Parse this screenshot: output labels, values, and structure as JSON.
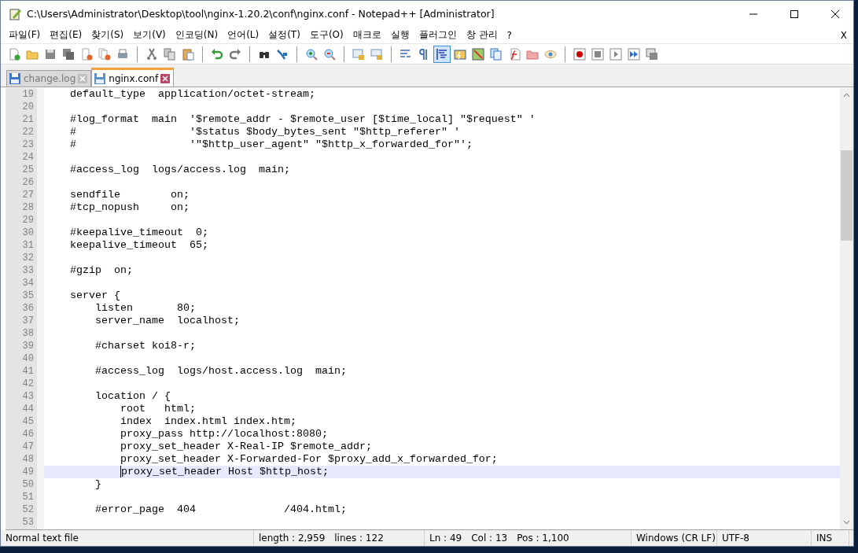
{
  "window": {
    "title": "C:\\Users\\Administrator\\Desktop\\tool\\nginx-1.20.2\\conf\\nginx.conf - Notepad++ [Administrator]"
  },
  "menu": {
    "items": [
      "파일(F)",
      "편집(E)",
      "찾기(S)",
      "보기(V)",
      "인코딩(N)",
      "언어(L)",
      "설정(T)",
      "도구(O)",
      "매크로",
      "실행",
      "플러그인",
      "창 관리",
      "?"
    ],
    "close_label": "X"
  },
  "toolbar": [
    [
      {
        "pressed": false
      },
      {
        "pressed": false
      },
      {
        "pressed": false
      },
      {
        "pressed": false
      },
      {
        "pressed": false
      },
      {
        "pressed": false
      },
      {
        "pressed": false
      }
    ],
    [
      {
        "pressed": false
      },
      {
        "pressed": false
      },
      {
        "pressed": false
      }
    ],
    [
      {
        "pressed": false
      },
      {
        "pressed": false
      }
    ],
    [
      {
        "pressed": false
      },
      {
        "pressed": false
      }
    ],
    [
      {
        "pressed": false
      },
      {
        "pressed": false
      }
    ],
    [
      {
        "pressed": false
      },
      {
        "pressed": false
      }
    ],
    [
      {
        "pressed": false
      },
      {
        "pressed": false
      },
      {
        "pressed": true
      },
      {
        "pressed": false
      },
      {
        "pressed": false
      },
      {
        "pressed": false
      },
      {
        "pressed": false
      },
      {
        "pressed": false
      },
      {
        "pressed": false
      }
    ],
    [
      {
        "pressed": false
      },
      {
        "pressed": false
      },
      {
        "pressed": false
      },
      {
        "pressed": false
      },
      {
        "pressed": false
      }
    ]
  ],
  "tabs": [
    {
      "label": "change.log",
      "selected": false
    },
    {
      "label": "nginx.conf",
      "selected": true
    }
  ],
  "editor": {
    "lines": [
      {
        "number": "19",
        "text": "    default_type  application/octet-stream;",
        "current": false
      },
      {
        "number": "20",
        "current": false
      },
      {
        "number": "21",
        "text": "    #log_format  main  '$remote_addr - $remote_user [$time_local] \"$request\" '",
        "current": false
      },
      {
        "number": "22",
        "text": "    #                  '$status $body_bytes_sent \"$http_referer\" '",
        "current": false
      },
      {
        "number": "23",
        "text": "    #                  '\"$http_user_agent\" \"$http_x_forwarded_for\"';",
        "current": false
      },
      {
        "number": "24",
        "current": false
      },
      {
        "number": "25",
        "text": "    #access_log  logs/access.log  main;",
        "current": false
      },
      {
        "number": "26",
        "current": false
      },
      {
        "number": "27",
        "text": "    sendfile        on;",
        "current": false
      },
      {
        "number": "28",
        "text": "    #tcp_nopush     on;",
        "current": false
      },
      {
        "number": "29",
        "current": false
      },
      {
        "number": "30",
        "text": "    #keepalive_timeout  0;",
        "current": false
      },
      {
        "number": "31",
        "text": "    keepalive_timeout  65;",
        "current": false
      },
      {
        "number": "32",
        "current": false
      },
      {
        "number": "33",
        "text": "    #gzip  on;",
        "current": false
      },
      {
        "number": "34",
        "current": false
      },
      {
        "number": "35",
        "text": "    server {",
        "current": false
      },
      {
        "number": "36",
        "text": "        listen       80;",
        "current": false
      },
      {
        "number": "37",
        "text": "        server_name  localhost;",
        "current": false
      },
      {
        "number": "38",
        "current": false
      },
      {
        "number": "39",
        "text": "        #charset koi8-r;",
        "current": false
      },
      {
        "number": "40",
        "current": false
      },
      {
        "number": "41",
        "text": "        #access_log  logs/host.access.log  main;",
        "current": false
      },
      {
        "number": "42",
        "current": false
      },
      {
        "number": "43",
        "text": "        location / {",
        "current": false
      },
      {
        "number": "44",
        "text": "            root   html;",
        "current": false
      },
      {
        "number": "45",
        "text": "            index  index.html index.htm;",
        "current": false
      },
      {
        "number": "46",
        "text": "            proxy_pass http://localhost:8080;",
        "current": false
      },
      {
        "number": "47",
        "text": "            proxy_set_header X-Real-IP $remote_addr;",
        "current": false
      },
      {
        "number": "48",
        "text": "            proxy_set_header X-Forwarded-For $proxy_add_x_forwarded_for;",
        "current": false
      },
      {
        "number": "49",
        "text": "            proxy_set_header Host $http_host;",
        "current": true
      },
      {
        "number": "50",
        "text": "        }",
        "current": false
      },
      {
        "number": "51",
        "current": false
      },
      {
        "number": "52",
        "text": "        #error_page  404              /404.html;",
        "current": false
      },
      {
        "number": "53",
        "current": false
      }
    ]
  },
  "status_bar": [
    [
      "Normal text file"
    ],
    [
      "length : 2,959",
      "lines : 122"
    ],
    [
      "Ln : 49",
      "Col : 13",
      "Pos : 1,100"
    ],
    [
      "Windows (CR LF)"
    ],
    [
      "UTF-8"
    ],
    [
      "INS"
    ]
  ]
}
